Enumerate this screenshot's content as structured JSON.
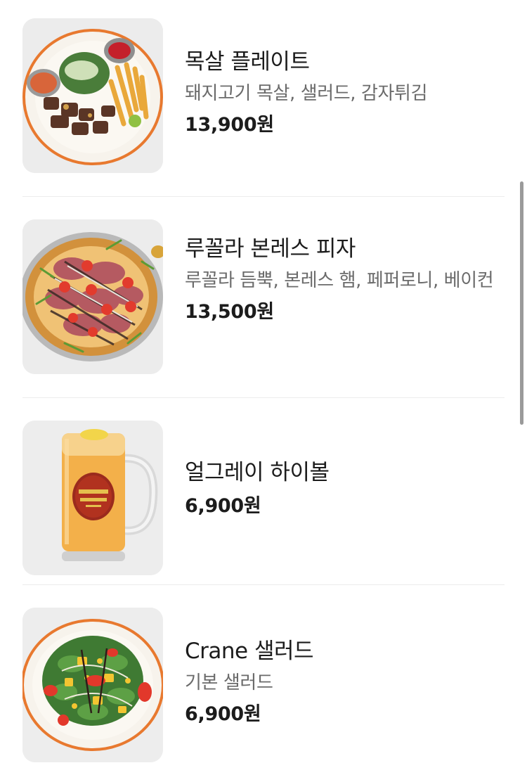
{
  "menu": {
    "items": [
      {
        "name": "목살 플레이트",
        "description": "돼지고기 목살, 샐러드, 감자튀김",
        "price": "13,900원",
        "image": "grilled-pork-plate-image"
      },
      {
        "name": "루꼴라 본레스 피자",
        "description": "루꼴라 듬뿍, 본레스 햄, 페퍼로니, 베이컨",
        "price": "13,500원",
        "image": "arugula-pizza-image"
      },
      {
        "name": "얼그레이 하이볼",
        "price": "6,900원",
        "image": "highball-mug-image"
      },
      {
        "name": "Crane 샐러드",
        "description": "기본 샐러드",
        "price": "6,900원",
        "image": "salad-plate-image"
      }
    ]
  },
  "colors": {
    "plate_rim": "#e8792f",
    "text_primary": "#1c1c1c",
    "text_secondary": "#6b6b6b",
    "divider": "#ececec"
  }
}
